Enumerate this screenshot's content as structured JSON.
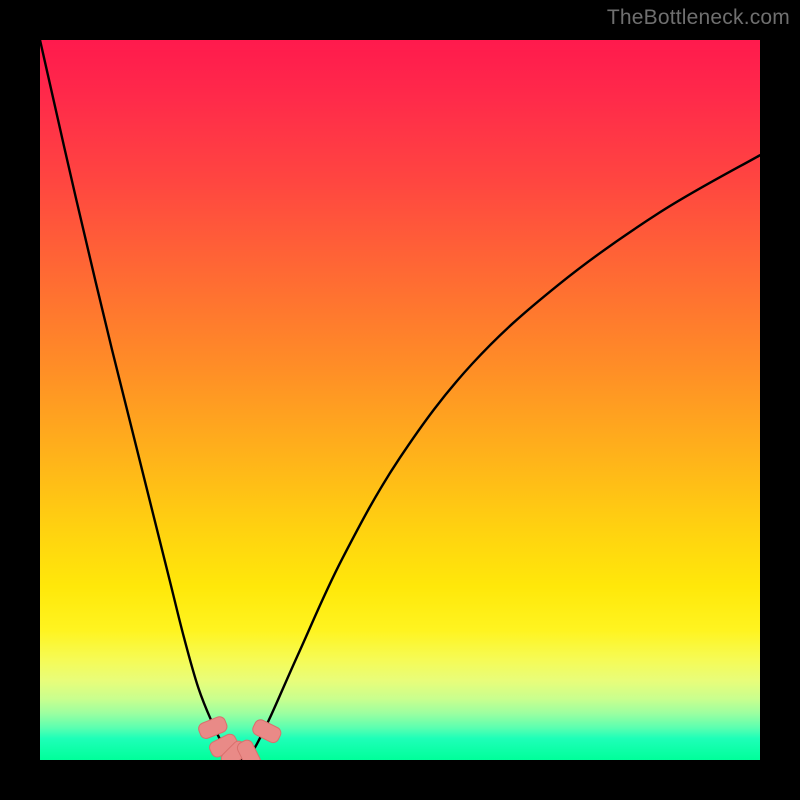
{
  "watermark": "TheBottleneck.com",
  "chart_data": {
    "type": "line",
    "title": "",
    "xlabel": "",
    "ylabel": "",
    "xlim": [
      0,
      100
    ],
    "ylim": [
      0,
      100
    ],
    "grid": false,
    "legend": false,
    "series": [
      {
        "name": "bottleneck-curve",
        "x": [
          0,
          5,
          10,
          15,
          18,
          20,
          22,
          24,
          25.5,
          27,
          28,
          29,
          30,
          32,
          36,
          42,
          50,
          60,
          72,
          86,
          100
        ],
        "values": [
          100,
          78,
          57,
          37,
          25,
          17,
          10,
          5,
          2,
          0.5,
          0,
          0.5,
          2,
          6,
          15,
          28,
          42,
          55,
          66,
          76,
          84
        ]
      }
    ],
    "markers": [
      {
        "name": "trough-point-1",
        "x": 24.0,
        "y": 4.5
      },
      {
        "name": "trough-point-2",
        "x": 25.5,
        "y": 2.0
      },
      {
        "name": "trough-point-3",
        "x": 27.0,
        "y": 0.8
      },
      {
        "name": "trough-point-4",
        "x": 29.0,
        "y": 0.8
      },
      {
        "name": "trough-point-5",
        "x": 31.5,
        "y": 4.0
      }
    ],
    "marker_style": {
      "color": "#e98a87",
      "stroke": "#d9706d",
      "rx": 6,
      "w": 16,
      "h": 28,
      "angle_follows_curve": true
    }
  }
}
